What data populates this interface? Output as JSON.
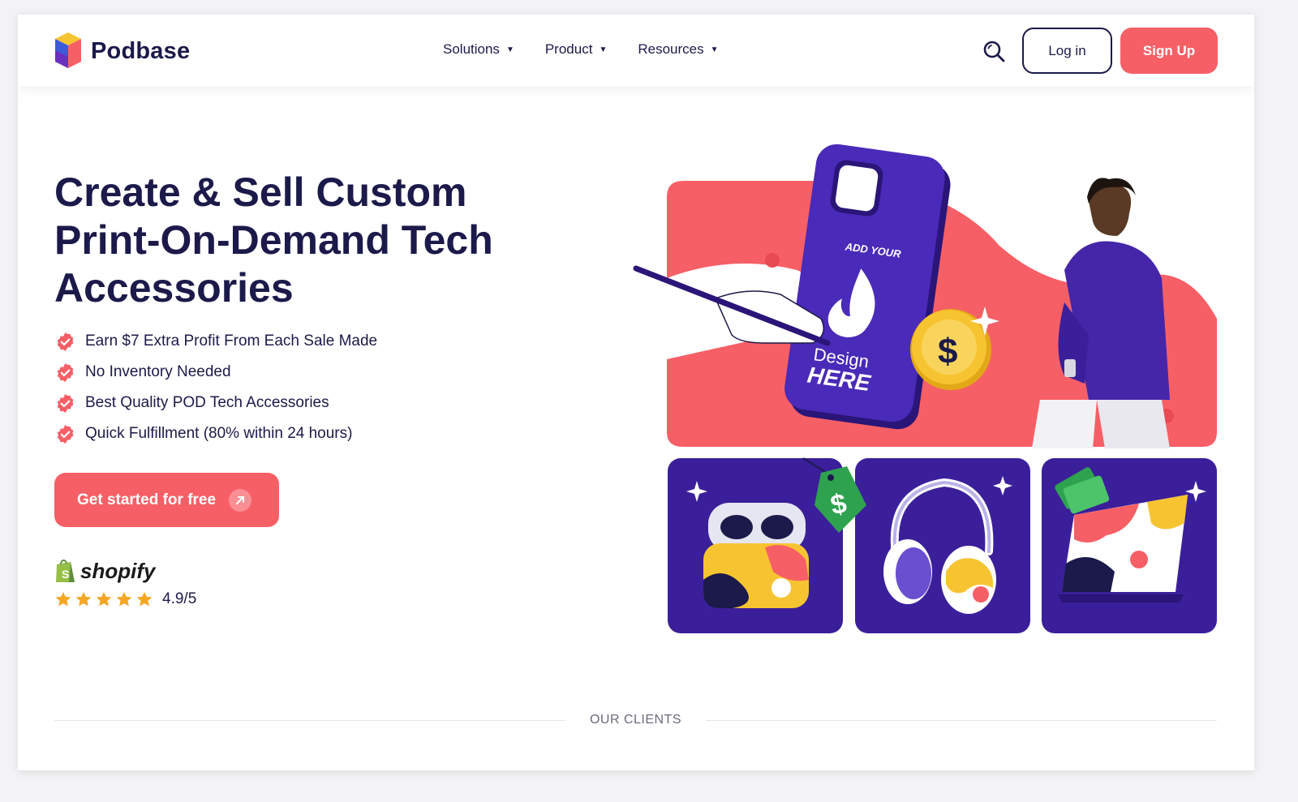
{
  "brand": {
    "name": "Podbase"
  },
  "nav": {
    "items": [
      {
        "label": "Solutions"
      },
      {
        "label": "Product"
      },
      {
        "label": "Resources"
      }
    ],
    "login_label": "Log in",
    "signup_label": "Sign Up"
  },
  "hero": {
    "title": "Create & Sell Custom Print-On-Demand Tech Accessories",
    "features": [
      "Earn $7 Extra Profit From Each Sale Made",
      "No Inventory Needed",
      "Best Quality POD Tech Accessories",
      "Quick Fulfillment (80% within 24 hours)"
    ],
    "cta_label": "Get started for free",
    "partner": "shopify",
    "rating": "4.9/5",
    "rating_stars": 5
  },
  "illustration": {
    "phone_text_top": "ADD YOUR",
    "phone_text_mid": "Design",
    "phone_text_bottom": "HERE",
    "coin_symbol": "$",
    "tag_symbol": "$"
  },
  "clients": {
    "label": "OUR CLIENTS"
  },
  "colors": {
    "accent": "#f75f66",
    "navy": "#1b1a4a",
    "purple": "#3b1f9a",
    "gold": "#f7c431",
    "green": "#2fa24f"
  }
}
